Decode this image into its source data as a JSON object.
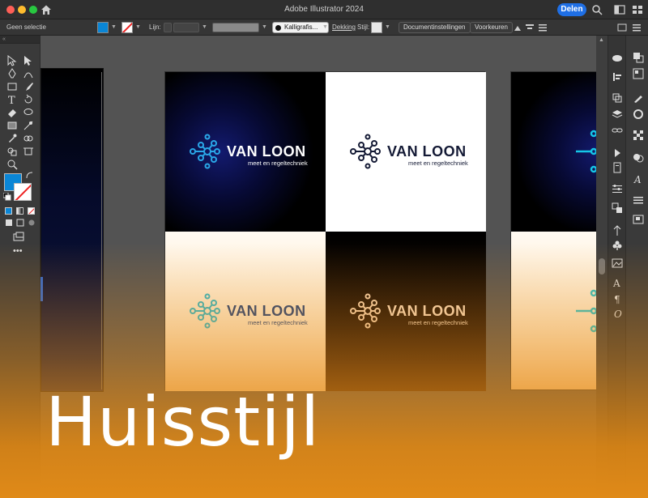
{
  "window": {
    "title": "Adobe Illustrator 2024",
    "share_label": "Delen"
  },
  "controlbar": {
    "selection_label": "Geen selectie",
    "stroke_label": "Lijn:",
    "brush_label": "Kalligrafis...",
    "opacity_label": "Dekking",
    "style_label": "Stijl:",
    "doc_settings_label": "Documentinstellingen",
    "prefs_label": "Voorkeuren"
  },
  "artboards": [
    {
      "brand": "VAN LOON",
      "tagline": "meet en regeltechniek"
    },
    {
      "brand": "VAN LOON",
      "tagline": "meet en regeltechniek"
    },
    {
      "brand": "VAN LOON",
      "tagline": "meet en regeltechniek"
    },
    {
      "brand": "VAN LOON",
      "tagline": "meet en regeltechniek"
    }
  ],
  "headline": "Huisstijl",
  "colors": {
    "accent_blue": "#1f6fe5",
    "fill": "#0a86d6",
    "overlay_orange": "#e08a18"
  }
}
